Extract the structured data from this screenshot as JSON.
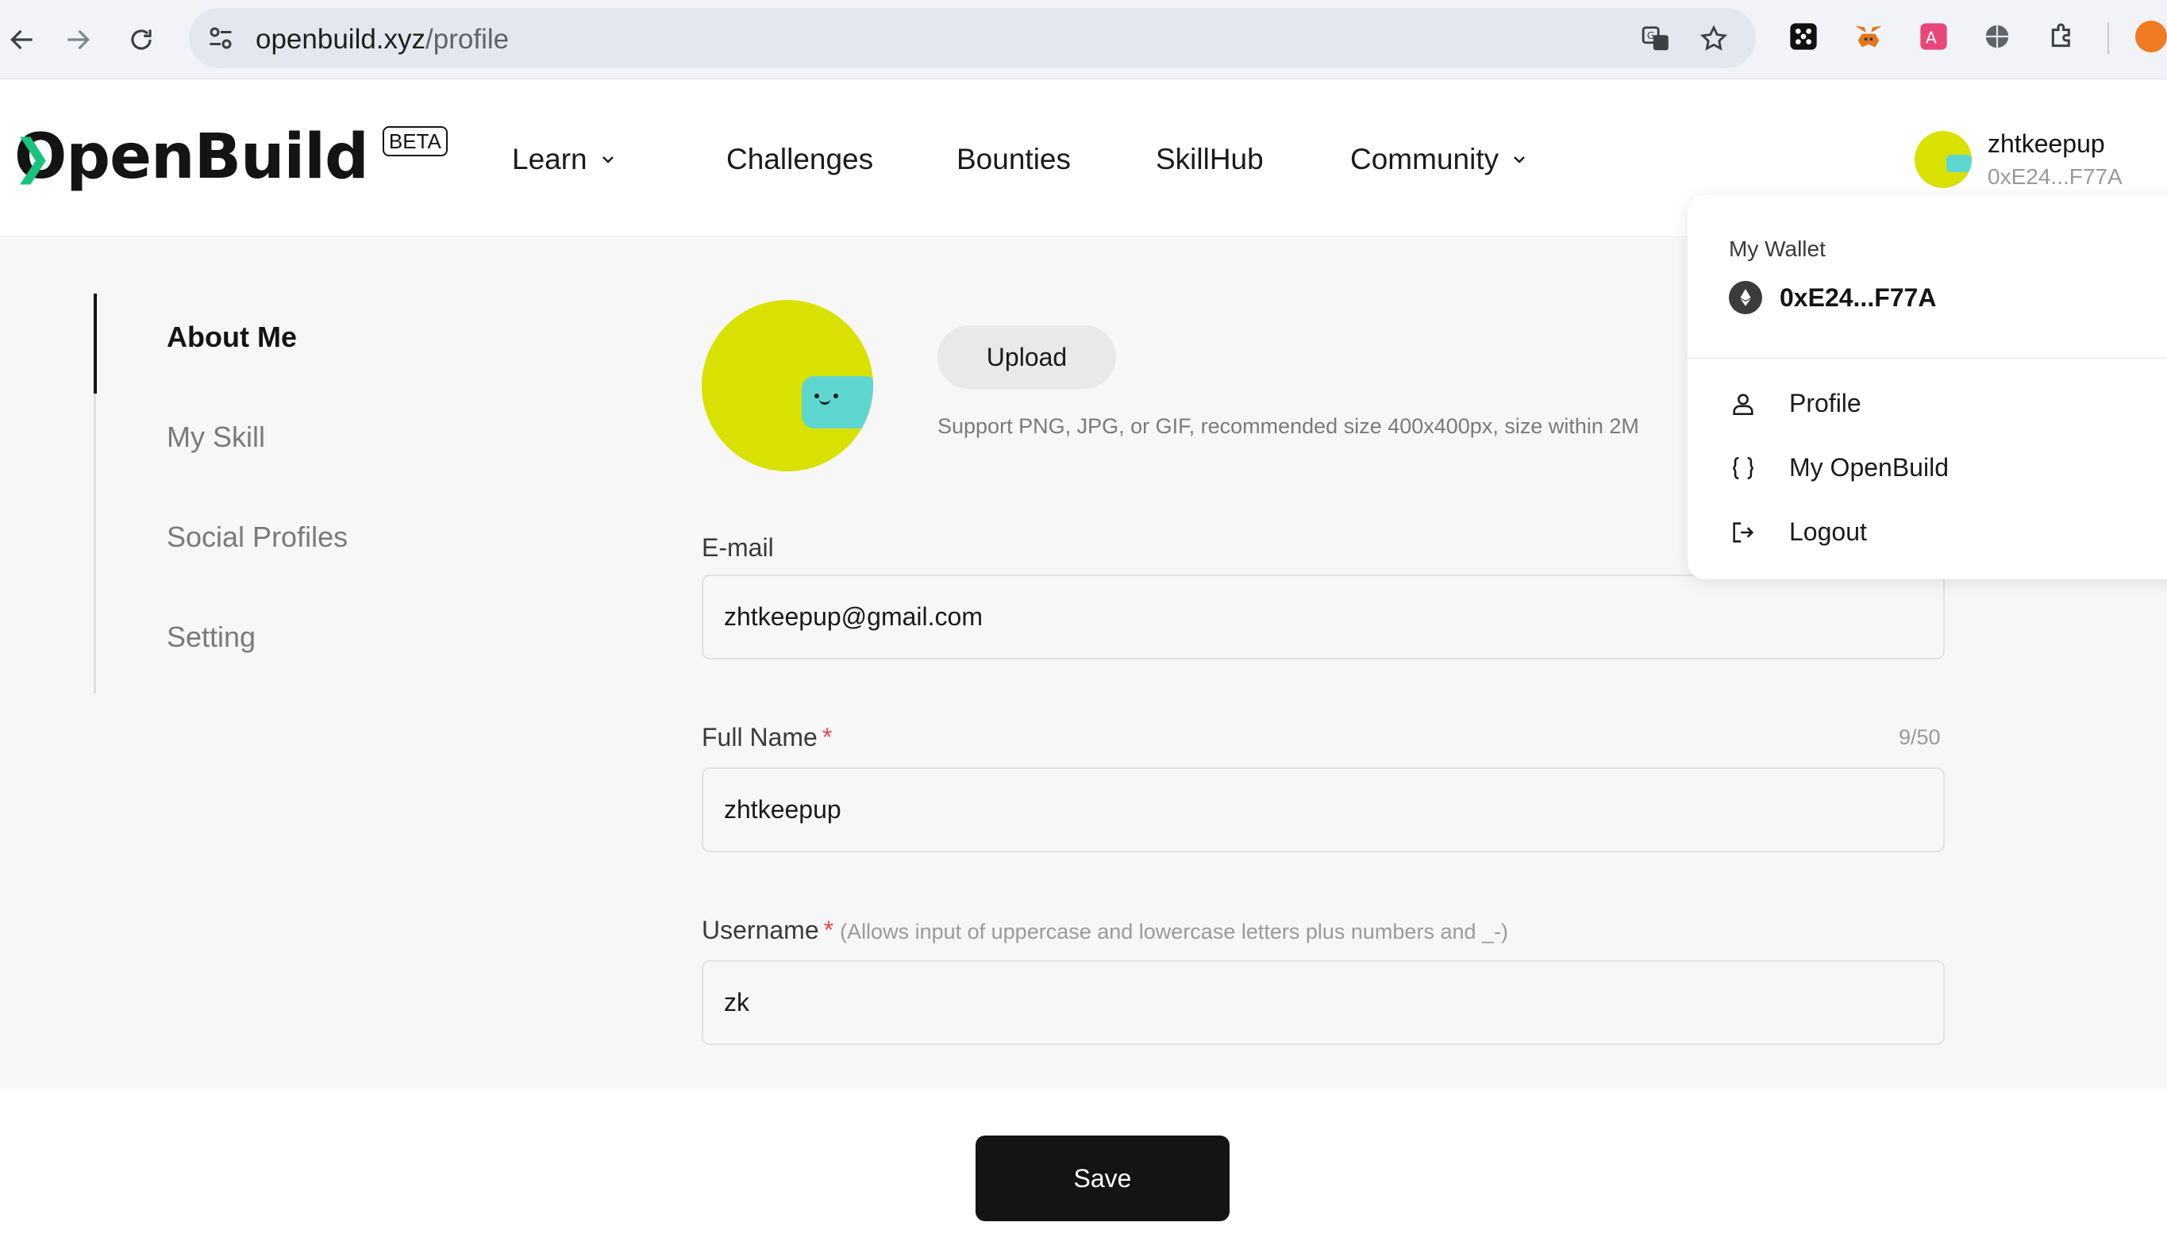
{
  "browser": {
    "url_host": "openbuild.xyz",
    "url_path": "/profile"
  },
  "header": {
    "logo_text": "OpenBuild",
    "beta_label": "BETA",
    "nav": [
      {
        "label": "Learn",
        "has_dropdown": true
      },
      {
        "label": "Challenges",
        "has_dropdown": false
      },
      {
        "label": "Bounties",
        "has_dropdown": false
      },
      {
        "label": "SkillHub",
        "has_dropdown": false
      },
      {
        "label": "Community",
        "has_dropdown": true
      }
    ],
    "user": {
      "name": "zhtkeepup",
      "address": "0xE24...F77A"
    }
  },
  "sidebar": {
    "items": [
      {
        "label": "About Me",
        "active": true
      },
      {
        "label": "My Skill",
        "active": false
      },
      {
        "label": "Social Profiles",
        "active": false
      },
      {
        "label": "Setting",
        "active": false
      }
    ]
  },
  "profile": {
    "upload_label": "Upload",
    "upload_hint": "Support PNG, JPG, or GIF, recommended size 400x400px, size within 2M",
    "email": {
      "label": "E-mail",
      "value": "zhtkeepup@gmail.com"
    },
    "full_name": {
      "label": "Full Name",
      "required_mark": "*",
      "count": "9/50",
      "value": "zhtkeepup"
    },
    "username": {
      "label": "Username",
      "required_mark": "*",
      "note": "(Allows input of uppercase and lowercase letters plus numbers and _-)",
      "value": "zk"
    },
    "save_label": "Save"
  },
  "dropdown": {
    "wallet_label": "My Wallet",
    "wallet_address": "0xE24...F77A",
    "items": [
      {
        "label": "Profile",
        "icon": "user-icon"
      },
      {
        "label": "My OpenBuild",
        "icon": "braces-icon"
      },
      {
        "label": "Logout",
        "icon": "logout-icon"
      }
    ]
  },
  "colors": {
    "avatar_yellow": "#d9e100",
    "avatar_cyan": "#5dd6d0",
    "logo_green": "#19c37d",
    "required_red": "#e5484d",
    "primary_dark": "#141414"
  }
}
